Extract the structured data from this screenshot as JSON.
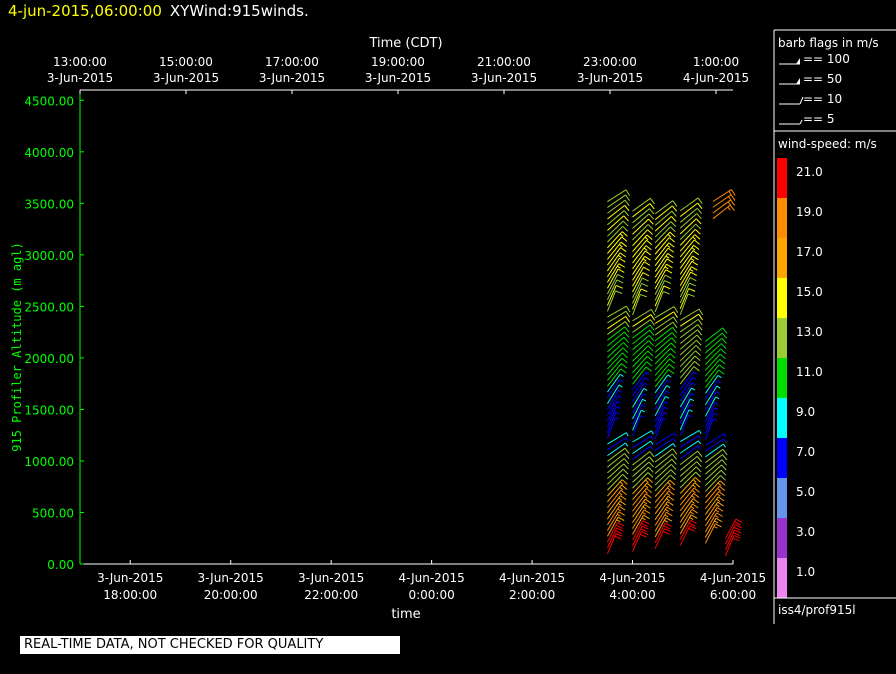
{
  "header": {
    "datetime": "4-jun-2015,06:00:00",
    "product": "XYWind:915winds."
  },
  "chart_data": {
    "type": "wind-barb-time-height",
    "top_axis": {
      "title": "Time (CDT)",
      "ticks": [
        {
          "time": "13:00:00",
          "date": "3-Jun-2015"
        },
        {
          "time": "15:00:00",
          "date": "3-Jun-2015"
        },
        {
          "time": "17:00:00",
          "date": "3-Jun-2015"
        },
        {
          "time": "19:00:00",
          "date": "3-Jun-2015"
        },
        {
          "time": "21:00:00",
          "date": "3-Jun-2015"
        },
        {
          "time": "23:00:00",
          "date": "3-Jun-2015"
        },
        {
          "time": "1:00:00",
          "date": "4-Jun-2015"
        }
      ]
    },
    "bottom_axis": {
      "title": "time",
      "ticks": [
        {
          "date": "3-Jun-2015",
          "time": "18:00:00"
        },
        {
          "date": "3-Jun-2015",
          "time": "20:00:00"
        },
        {
          "date": "3-Jun-2015",
          "time": "22:00:00"
        },
        {
          "date": "4-Jun-2015",
          "time": "0:00:00"
        },
        {
          "date": "4-Jun-2015",
          "time": "2:00:00"
        },
        {
          "date": "4-Jun-2015",
          "time": "4:00:00"
        },
        {
          "date": "4-Jun-2015",
          "time": "6:00:00"
        }
      ],
      "range_utc_hours": [
        17.0,
        30.0
      ]
    },
    "y_axis": {
      "title": "915 Profiler Altitude (m agl)",
      "ticks": [
        "0.00",
        "500.00",
        "1000.00",
        "1500.00",
        "2000.00",
        "2500.00",
        "3000.00",
        "3500.00",
        "4000.00",
        "4500.00"
      ],
      "range": [
        0,
        4600
      ]
    },
    "profiles": [
      {
        "t": 27.5,
        "alt_range": [
          100,
          3550
        ],
        "color_pattern": "mixed"
      },
      {
        "t": 28.0,
        "alt_range": [
          120,
          3450
        ],
        "color_pattern": "mixed"
      },
      {
        "t": 28.45,
        "alt_range": [
          150,
          3400
        ],
        "color_pattern": "mixed"
      },
      {
        "t": 28.95,
        "alt_range": [
          180,
          3450
        ],
        "color_pattern": "mixed"
      },
      {
        "t": 29.45,
        "alt_range": [
          200,
          2200
        ],
        "color_pattern": "upper-lower"
      },
      {
        "t": 29.85,
        "alt_range": [
          80,
          250
        ],
        "color_pattern": "red"
      },
      {
        "t": 29.6,
        "alt_range": [
          3350,
          3550
        ],
        "color_pattern": "orange"
      }
    ]
  },
  "legend": {
    "barb_title": "barb flags in m/s",
    "barb_entries": [
      {
        "label": "== 100",
        "kind": "flag"
      },
      {
        "label": "== 50",
        "kind": "flag"
      },
      {
        "label": "== 10",
        "kind": "full"
      },
      {
        "label": "== 5",
        "kind": "half"
      }
    ],
    "speed_title": "wind-speed: m/s",
    "speed_bins": [
      {
        "label": "21.0",
        "color": "#ff0000"
      },
      {
        "label": "19.0",
        "color": "#ff8c00"
      },
      {
        "label": "17.0",
        "color": "#ffa500"
      },
      {
        "label": "15.0",
        "color": "#ffff00"
      },
      {
        "label": "13.0",
        "color": "#9acd32"
      },
      {
        "label": "11.0",
        "color": "#00dd00"
      },
      {
        "label": "9.0",
        "color": "#00ffff"
      },
      {
        "label": "7.0",
        "color": "#0000ff"
      },
      {
        "label": "5.0",
        "color": "#6495ed"
      },
      {
        "label": "3.0",
        "color": "#9932cc"
      },
      {
        "label": "1.0",
        "color": "#ee82ee"
      }
    ],
    "source": "iss4/prof915l"
  },
  "footer": {
    "qc_notice": "REAL-TIME DATA, NOT CHECKED FOR QUALITY"
  },
  "colors": {
    "axis_text": "#00ff00",
    "frame": "#ffffff",
    "header_date": "#ffff00"
  }
}
